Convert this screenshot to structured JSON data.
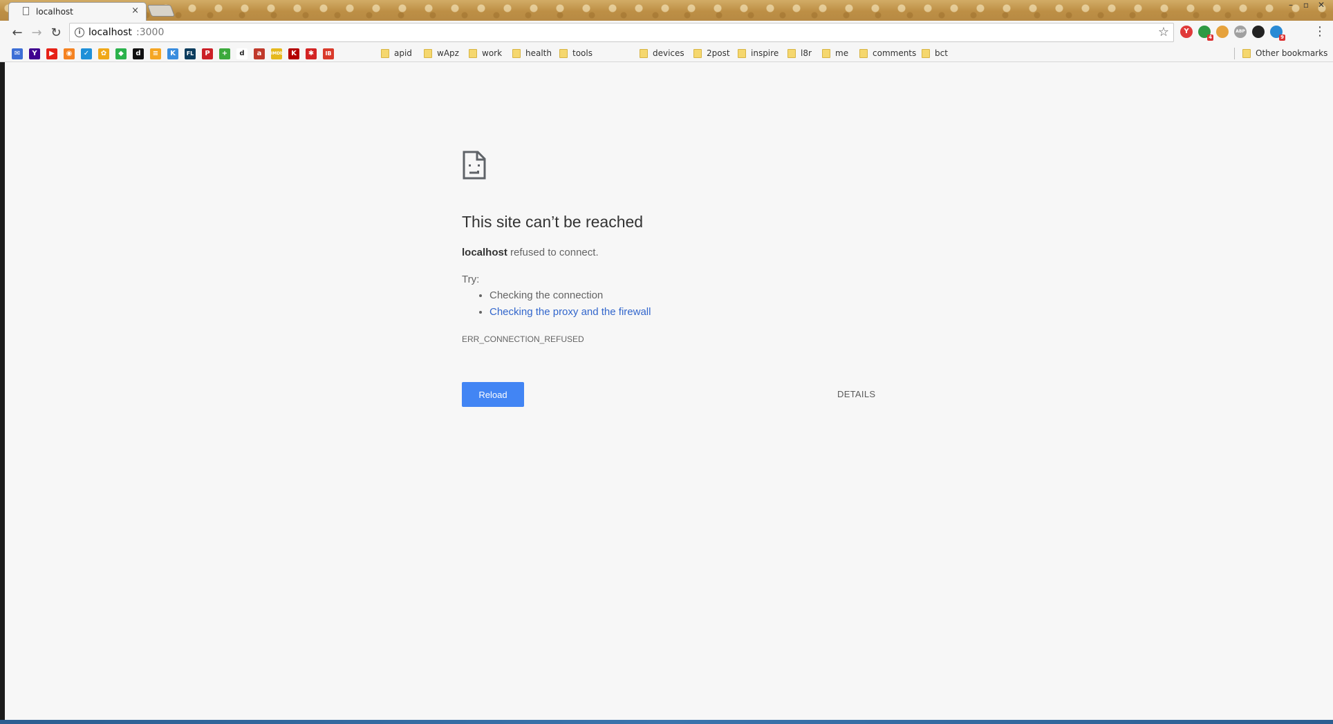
{
  "tab": {
    "title": "localhost",
    "close": "×"
  },
  "window_controls": {
    "min": "–",
    "max": "▫",
    "close": "✕"
  },
  "toolbar": {
    "back": "←",
    "forward": "→",
    "reload": "↻",
    "url_host": "localhost",
    "url_port": ":3000",
    "star": "☆",
    "menu": "⋮"
  },
  "extensions": [
    {
      "name": "yandex-icon",
      "label": "Y",
      "color": "#e03a3a"
    },
    {
      "name": "green-ext-icon",
      "label": "",
      "color": "#2f9a44",
      "badge": "4"
    },
    {
      "name": "basket-icon",
      "label": "",
      "color": "#e6a23c"
    },
    {
      "name": "abp-icon",
      "label": "ABP",
      "color": "#a0a0a0"
    },
    {
      "name": "incognito-ext-icon",
      "label": "",
      "color": "#222222"
    },
    {
      "name": "blue-check-ext-icon",
      "label": "",
      "color": "#2a8ad4",
      "badge": "9"
    }
  ],
  "bookmark_icons": [
    {
      "name": "gmail-bookmark-icon",
      "label": "✉",
      "color": "#3d6fd6"
    },
    {
      "name": "yahoo-bookmark-icon",
      "label": "Y",
      "color": "#400190"
    },
    {
      "name": "youtube-bookmark-icon",
      "label": "▶",
      "color": "#e62117"
    },
    {
      "name": "rss-bookmark-icon",
      "label": "◉",
      "color": "#f58220"
    },
    {
      "name": "check-bookmark-icon",
      "label": "✓",
      "color": "#1f90d8"
    },
    {
      "name": "gear-bookmark-icon",
      "label": "✿",
      "color": "#f0a818"
    },
    {
      "name": "feedly-bookmark-icon",
      "label": "◆",
      "color": "#2bb24c"
    },
    {
      "name": "digg-bookmark-icon",
      "label": "d",
      "color": "#111111"
    },
    {
      "name": "layers-bookmark-icon",
      "label": "≡",
      "color": "#f5a623"
    },
    {
      "name": "kk-bookmark-icon",
      "label": "K",
      "color": "#3a8dde"
    },
    {
      "name": "fl-bookmark-icon",
      "label": "FL",
      "color": "#0b3c5d"
    },
    {
      "name": "pinterest-bookmark-icon",
      "label": "P",
      "color": "#cb2027"
    },
    {
      "name": "plus-bookmark-icon",
      "label": "+",
      "color": "#3caa3c"
    },
    {
      "name": "d-bookmark-icon",
      "label": "d",
      "color": "#ffffff"
    },
    {
      "name": "amazon-bookmark-icon",
      "label": "a",
      "color": "#c0392b"
    },
    {
      "name": "imdb-bookmark-icon",
      "label": "IMDb",
      "color": "#e6b91e"
    },
    {
      "name": "k-bookmark-icon",
      "label": "K",
      "color": "#b40000"
    },
    {
      "name": "yelp-bookmark-icon",
      "label": "✱",
      "color": "#d32323"
    },
    {
      "name": "news-bookmark-icon",
      "label": "IB",
      "color": "#d93a2b"
    }
  ],
  "bookmark_folders": [
    {
      "name": "bookmark-folder-apid",
      "label": "apid"
    },
    {
      "name": "bookmark-folder-wapz",
      "label": "wApz"
    },
    {
      "name": "bookmark-folder-work",
      "label": "work"
    },
    {
      "name": "bookmark-folder-health",
      "label": "health"
    },
    {
      "name": "bookmark-folder-tools",
      "label": "tools"
    },
    {
      "name": "bookmark-folder-devices",
      "label": "devices"
    },
    {
      "name": "bookmark-folder-2post",
      "label": "2post"
    },
    {
      "name": "bookmark-folder-inspire",
      "label": "inspire"
    },
    {
      "name": "bookmark-folder-l8r",
      "label": "l8r"
    },
    {
      "name": "bookmark-folder-me",
      "label": "me"
    },
    {
      "name": "bookmark-folder-comments",
      "label": "comments"
    },
    {
      "name": "bookmark-folder-bct",
      "label": "bct"
    }
  ],
  "other_bookmarks": "Other bookmarks",
  "error": {
    "heading": "This site can’t be reached",
    "host": "localhost",
    "summary_rest": " refused to connect.",
    "try_label": "Try:",
    "suggestion_1": "Checking the connection",
    "suggestion_2": "Checking the proxy and the firewall",
    "code": "ERR_CONNECTION_REFUSED",
    "reload_label": "Reload",
    "details_label": "DETAILS"
  },
  "colors": {
    "accent": "#4285f4",
    "link": "#3266cc",
    "page_bg": "#f7f7f7"
  }
}
